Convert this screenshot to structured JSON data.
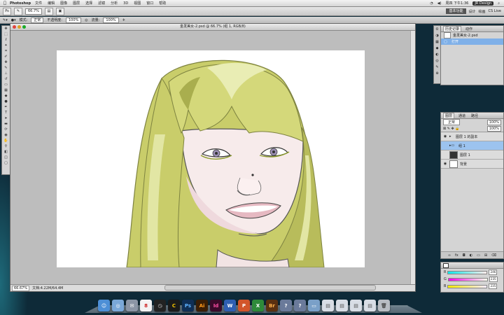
{
  "menubar": {
    "app_name": "Photoshop",
    "items": [
      "文件",
      "编辑",
      "图像",
      "图层",
      "选择",
      "滤镜",
      "分析",
      "3D",
      "视图",
      "窗口",
      "帮助"
    ],
    "clock": "周四 下午1:36",
    "workspace": "JR Design",
    "search": "CS Live"
  },
  "options_bar": {
    "zoom": "66.7%",
    "mode_label": "模式:",
    "mode_value": "正常",
    "opacity_label": "不透明度:",
    "opacity_value": "100%",
    "flow_label": "流量:",
    "flow_value": "100%",
    "workspace_button": "基本功能",
    "design": "设计",
    "painting": "绘画"
  },
  "document": {
    "title": "金发美女-2.psd @ 66.7% (组 1, RGB/8)",
    "zoom": "66.67%",
    "doc_size": "文档:4.22M/64.4M"
  },
  "history_panel": {
    "tabs": [
      "历史记录",
      "动作"
    ],
    "items": [
      {
        "label": "金发美女-2.psd",
        "selected": false
      },
      {
        "label": "打开",
        "selected": true
      }
    ]
  },
  "layers_panel": {
    "tabs": [
      "图层",
      "通道",
      "路径"
    ],
    "blend_mode": "正常",
    "opacity": "100%",
    "fill": "100%",
    "layers": [
      {
        "name": "图层 1 的副本",
        "selected": false
      },
      {
        "name": "组 1",
        "selected": true
      },
      {
        "name": "图层 1",
        "selected": false
      },
      {
        "name": "背景",
        "selected": false
      }
    ]
  },
  "color_panel": {
    "r": "246",
    "g": "235",
    "b": "235"
  },
  "colors": {
    "hair": "#c9cd6a",
    "hair_light": "#e2e6a4",
    "hair_dark": "#a9ae4e",
    "skin": "#f7ebeb",
    "selection": "#9cc3ef"
  },
  "dock_icons": [
    "finder",
    "safari",
    "mail",
    "ical",
    "clock",
    "ps",
    "ai",
    "id",
    "word",
    "powerpoint",
    "excel",
    "bridge",
    "help",
    "help2",
    "folder",
    "window1",
    "window2",
    "window3",
    "window4",
    "trash"
  ]
}
